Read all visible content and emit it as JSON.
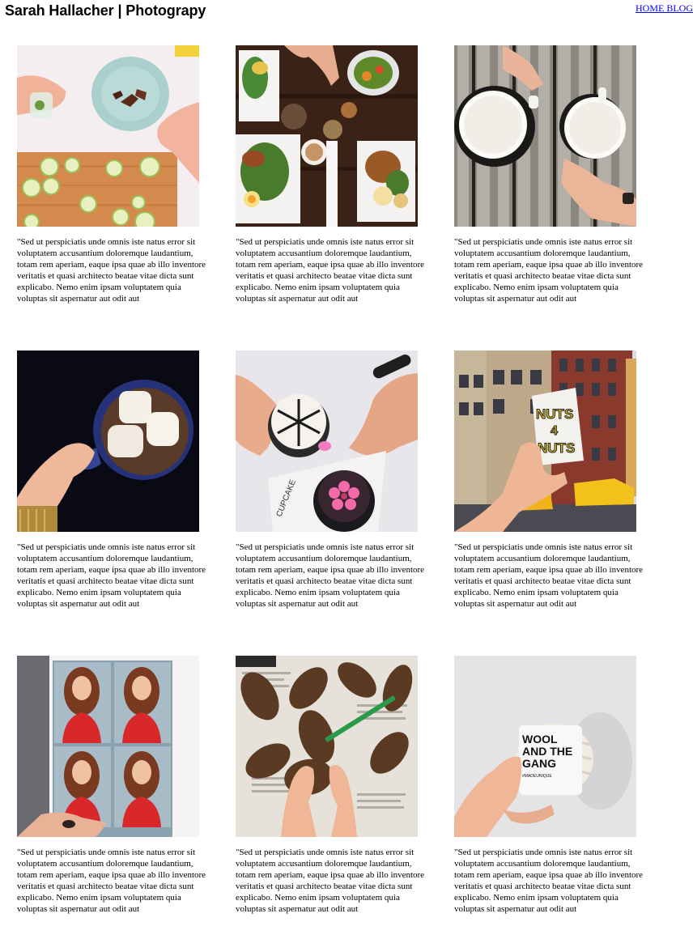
{
  "site": {
    "title": "Sarah Hallacher | Photograpy"
  },
  "nav": {
    "home_blog": "HOME BLOG"
  },
  "colors": {
    "link": "#0000ee",
    "text": "#000000",
    "background": "#ffffff"
  },
  "gallery": {
    "items": [
      {
        "subject": "food prep with cucumber slices on cutting board",
        "caption": "\"Sed ut perspiciatis unde omnis iste natus error sit voluptatem accusantium doloremque laudantium, totam rem aperiam, eaque ipsa quae ab illo inventore veritatis et quasi architecto beatae vitae dicta sunt explicabo. Nemo enim ipsam voluptatem quia voluptas sit aspernatur aut odit aut"
      },
      {
        "subject": "brunch table spread viewed from above",
        "caption": "\"Sed ut perspiciatis unde omnis iste natus error sit voluptatem accusantium doloremque laudantium, totam rem aperiam, eaque ipsa quae ab illo inventore veritatis et quasi architecto beatae vitae dicta sunt explicabo. Nemo enim ipsam voluptatem quia voluptas sit aspernatur aut odit aut"
      },
      {
        "subject": "two coffee cups on wooden bench",
        "caption": "\"Sed ut perspiciatis unde omnis iste natus error sit voluptatem accusantium doloremque laudantium, totam rem aperiam, eaque ipsa quae ab illo inventore veritatis et quasi architecto beatae vitae dicta sunt explicabo. Nemo enim ipsam voluptatem quia voluptas sit aspernatur aut odit aut"
      },
      {
        "subject": "hot chocolate with marshmallows",
        "caption": "\"Sed ut perspiciatis unde omnis iste natus error sit voluptatem accusantium doloremque laudantium, totam rem aperiam, eaque ipsa quae ab illo inventore veritatis et quasi architecto beatae vitae dicta sunt explicabo. Nemo enim ipsam voluptatem quia voluptas sit aspernatur aut odit aut"
      },
      {
        "subject": "decorated cupcakes held in hands",
        "caption": "\"Sed ut perspiciatis unde omnis iste natus error sit voluptatem accusantium doloremque laudantium, totam rem aperiam, eaque ipsa quae ab illo inventore veritatis et quasi architecto beatae vitae dicta sunt explicabo. Nemo enim ipsam voluptatem quia voluptas sit aspernatur aut odit aut"
      },
      {
        "subject": "snack bag held up on city street with taxis",
        "caption": "\"Sed ut perspiciatis unde omnis iste natus error sit voluptatem accusantium doloremque laudantium, totam rem aperiam, eaque ipsa quae ab illo inventore veritatis et quasi architecto beatae vitae dicta sunt explicabo. Nemo enim ipsam voluptatem quia voluptas sit aspernatur aut odit aut"
      },
      {
        "subject": "photo booth print held in hand",
        "caption": "\"Sed ut perspiciatis unde omnis iste natus error sit voluptatem accusantium doloremque laudantium, totam rem aperiam, eaque ipsa quae ab illo inventore veritatis et quasi architecto beatae vitae dicta sunt explicabo. Nemo enim ipsam voluptatem quia voluptas sit aspernatur aut odit aut"
      },
      {
        "subject": "painting pine cones on newspaper",
        "caption": "\"Sed ut perspiciatis unde omnis iste natus error sit voluptatem accusantium doloremque laudantium, totam rem aperiam, eaque ipsa quae ab illo inventore veritatis et quasi architecto beatae vitae dicta sunt explicabo. Nemo enim ipsam voluptatem quia voluptas sit aspernatur aut odit aut"
      },
      {
        "subject": "skein of yarn held in hand",
        "caption": "\"Sed ut perspiciatis unde omnis iste natus error sit voluptatem accusantium doloremque laudantium, totam rem aperiam, eaque ipsa quae ab illo inventore veritatis et quasi architecto beatae vitae dicta sunt explicabo. Nemo enim ipsam voluptatem quia voluptas sit aspernatur aut odit aut"
      }
    ]
  },
  "photo_labels": {
    "nuts_brand": [
      "NUTS",
      "4",
      "NUTS"
    ],
    "yarn_brand": [
      "WOOL",
      "AND THE",
      "GANG"
    ],
    "yarn_tag": "#MADEUNIQUE",
    "cupcake_box": "CUPCAKE"
  }
}
